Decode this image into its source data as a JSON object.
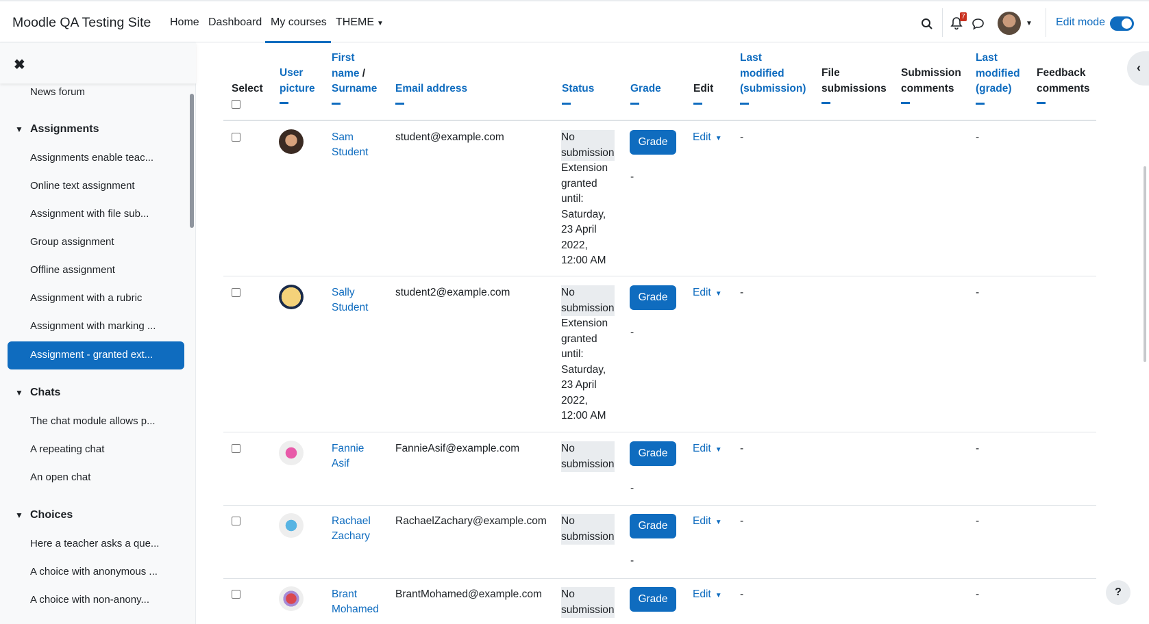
{
  "brand": "Moodle QA Testing Site",
  "nav": {
    "home": "Home",
    "dashboard": "Dashboard",
    "my_courses": "My courses",
    "theme": "THEME"
  },
  "notifications_count": "7",
  "edit_mode_label": "Edit mode",
  "drawer": {
    "items": {
      "news_forum": "News forum",
      "a1": "Assignments enable teac...",
      "a2": "Online text assignment",
      "a3": "Assignment with file sub...",
      "a4": "Group assignment",
      "a5": "Offline assignment",
      "a6": "Assignment with a rubric",
      "a7": "Assignment with marking ...",
      "a8": "Assignment - granted ext...",
      "c1": "The chat module allows p...",
      "c2": "A repeating chat",
      "c3": "An open chat",
      "ch1": "Here a teacher asks a que...",
      "ch2": "A choice with anonymous ...",
      "ch3": "A choice with non-anony..."
    },
    "sections": {
      "assignments": "Assignments",
      "chats": "Chats",
      "choices": "Choices"
    }
  },
  "table": {
    "headers": {
      "select": "Select",
      "user_picture_1": "User",
      "user_picture_2": "picture",
      "first_name_1": "First",
      "first_name_2": "name",
      "slash": " /",
      "surname": "Surname",
      "email": "Email address",
      "status": "Status",
      "grade": "Grade",
      "edit": "Edit",
      "lm_sub_1": "Last",
      "lm_sub_2": "modified",
      "lm_sub_3": "(submission)",
      "file_sub_1": "File",
      "file_sub_2": "submissions",
      "sub_comm_1": "Submission",
      "sub_comm_2": "comments",
      "lm_grade_1": "Last",
      "lm_grade_2": "modified",
      "lm_grade_3": "(grade)",
      "fb_1": "Feedback",
      "fb_2": "comments"
    },
    "rows": [
      {
        "first": "Sam",
        "last": "Student",
        "email": "student@example.com",
        "status_1": "No",
        "status_2": "submission",
        "ext": "Extension granted until: Saturday, 23 April 2022, 12:00 AM"
      },
      {
        "first": "Sally",
        "last": "Student",
        "email": "student2@example.com",
        "status_1": "No",
        "status_2": "submission",
        "ext": "Extension granted until: Saturday, 23 April 2022, 12:00 AM"
      },
      {
        "first": "Fannie",
        "last": "Asif",
        "email": "FannieAsif@example.com",
        "status_1": "No",
        "status_2": "submission"
      },
      {
        "first": "Rachael",
        "last": "Zachary",
        "email": "RachaelZachary@example.com",
        "status_1": "No",
        "status_2": "submission"
      },
      {
        "first": "Brant",
        "last": "Mohamed",
        "email": "BrantMohamed@example.com",
        "status_1": "No",
        "status_2": "submission"
      }
    ],
    "grade_button": "Grade",
    "edit_label": "Edit",
    "dash": "-"
  },
  "help_label": "?"
}
